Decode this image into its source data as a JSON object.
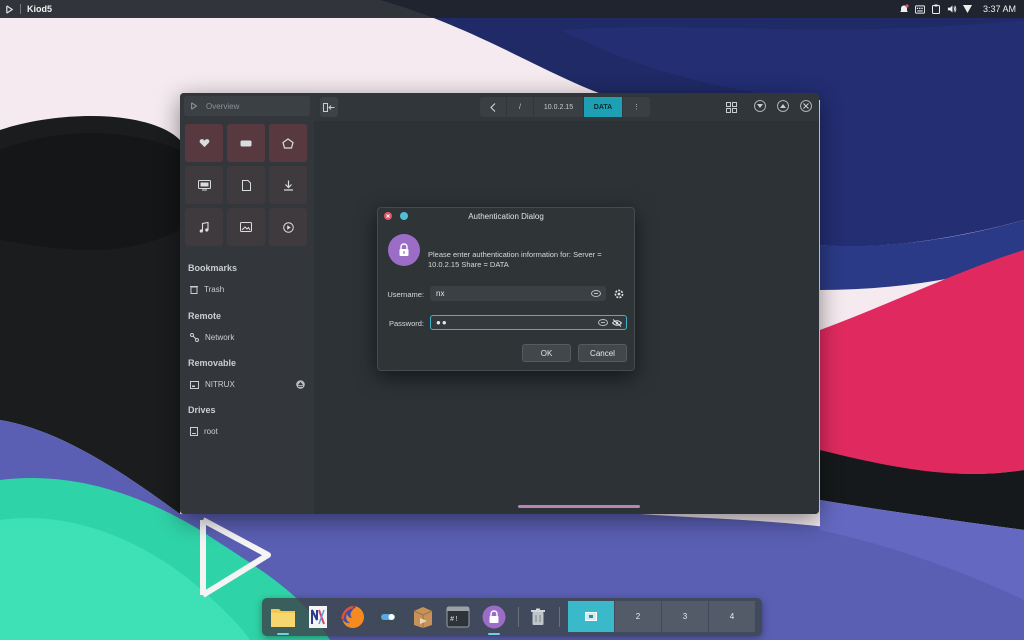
{
  "top_panel": {
    "app_name": "Kiod5",
    "clock": "3:37 AM",
    "icons": [
      "nitrux-logo-icon",
      "notification-bell-icon",
      "keyboard-icon",
      "clipboard-icon",
      "volume-icon",
      "network-icon"
    ]
  },
  "file_manager": {
    "sidebar": {
      "overview_label": "Overview",
      "quick_places": [
        "favorites-heart-icon",
        "recent-icon",
        "home-icon",
        "desktop-icon",
        "documents-icon",
        "downloads-icon",
        "music-icon",
        "pictures-icon",
        "videos-icon"
      ],
      "sections": [
        {
          "title": "Bookmarks",
          "items": [
            {
              "label": "Trash",
              "icon": "trash-icon"
            }
          ]
        },
        {
          "title": "Remote",
          "items": [
            {
              "label": "Network",
              "icon": "network-icon"
            }
          ]
        },
        {
          "title": "Removable",
          "items": [
            {
              "label": "NITRUX",
              "icon": "drive-removable-icon"
            }
          ]
        },
        {
          "title": "Drives",
          "items": [
            {
              "label": "root",
              "icon": "drive-icon"
            }
          ]
        }
      ]
    },
    "toolbar": {
      "breadcrumbs": [
        "/",
        "10.0.2.15",
        "DATA"
      ],
      "more_label": "⋮"
    }
  },
  "auth_dialog": {
    "title": "Authentication Dialog",
    "message": "Please enter authentication information for: Server = 10.0.2.15 Share = DATA",
    "username_label": "Username:",
    "username_value": "nx",
    "password_label": "Password:",
    "password_value": "●●",
    "ok_label": "OK",
    "cancel_label": "Cancel"
  },
  "dock": {
    "apps": [
      "file-manager-icon",
      "text-editor-icon",
      "firefox-icon",
      "settings-icon",
      "software-center-icon",
      "terminal-icon",
      "authentication-lock-icon"
    ],
    "trash_icon": "trash-icon",
    "workspaces": [
      "",
      "2",
      "3",
      "4"
    ],
    "active_workspace": 1
  },
  "colors": {
    "accent": "#1ea0b4",
    "lock_purple": "#9b6dc7",
    "close_red": "#e0566a"
  }
}
